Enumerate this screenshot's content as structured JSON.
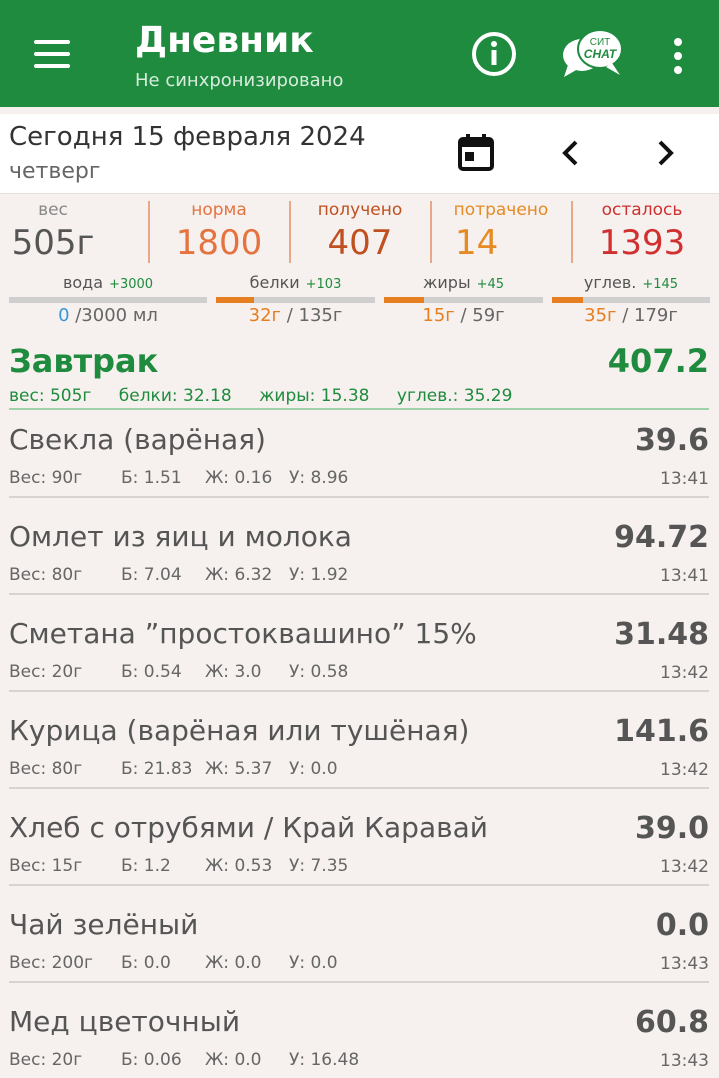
{
  "appbar": {
    "title": "Дневник",
    "subtitle": "Не синхронизировано",
    "chat_logo": [
      "СИТ",
      "CHAT"
    ],
    "icons": [
      "menu-icon",
      "info-icon",
      "chat-logo-icon",
      "more-vert-icon"
    ]
  },
  "date": {
    "full": "Сегодня 15 февраля 2024",
    "weekday": "четверг",
    "icons": [
      "calendar-icon",
      "chevron-left-icon",
      "chevron-right-icon"
    ]
  },
  "stats": [
    {
      "label": "вес",
      "value": "505г",
      "color": "#555555"
    },
    {
      "label": "норма",
      "value": "1800",
      "color": "#e5733f"
    },
    {
      "label": "получено",
      "value": "407",
      "color": "#c0501f"
    },
    {
      "label": "потрачено",
      "value": "14",
      "color": "#e68a23"
    },
    {
      "label": "осталось",
      "value": "1393",
      "color": "#d03030"
    }
  ],
  "macros": [
    {
      "label": "вода",
      "plus": "+3000",
      "current": "0",
      "rest": " /3000 мл",
      "fill": 0.0
    },
    {
      "label": "белки",
      "plus": "+103",
      "current": "32г",
      "rest": " / 135г",
      "fill": 0.237
    },
    {
      "label": "жиры",
      "plus": "+45",
      "current": "15г",
      "rest": " / 59г",
      "fill": 0.254
    },
    {
      "label": "углев.",
      "plus": "+145",
      "current": "35г",
      "rest": " / 179г",
      "fill": 0.196
    }
  ],
  "meal": {
    "title": "Завтрак",
    "total": "407.2",
    "weight": "вес: 505г",
    "protein": "белки: 32.18",
    "fat": "жиры: 15.38",
    "carbs": "углев.: 35.29"
  },
  "items": [
    {
      "name": "Свекла (варёная)",
      "kcal": "39.6",
      "weight": "Вес: 90г",
      "b": "Б: 1.51",
      "f": "Ж: 0.16",
      "c": "У: 8.96",
      "time": "13:41"
    },
    {
      "name": "Омлет из яиц и молока",
      "kcal": "94.72",
      "weight": "Вес: 80г",
      "b": "Б: 7.04",
      "f": "Ж: 6.32",
      "c": "У: 1.92",
      "time": "13:41"
    },
    {
      "name": "Сметана ”простоквашино” 15%",
      "kcal": "31.48",
      "weight": "Вес: 20г",
      "b": "Б: 0.54",
      "f": "Ж: 3.0",
      "c": "У: 0.58",
      "time": "13:42"
    },
    {
      "name": "Курица (варёная или тушёная)",
      "kcal": "141.6",
      "weight": "Вес: 80г",
      "b": "Б: 21.83",
      "f": "Ж: 5.37",
      "c": "У: 0.0",
      "time": "13:42"
    },
    {
      "name": "Хлеб с отрубями / Край Каравай",
      "kcal": "39.0",
      "weight": "Вес: 15г",
      "b": "Б: 1.2",
      "f": "Ж: 0.53",
      "c": "У: 7.35",
      "time": "13:42"
    },
    {
      "name": "Чай зелёный",
      "kcal": "0.0",
      "weight": "Вес: 200г",
      "b": "Б: 0.0",
      "f": "Ж: 0.0",
      "c": "У: 0.0",
      "time": "13:43"
    },
    {
      "name": "Мед цветочный",
      "kcal": "60.8",
      "weight": "Вес: 20г",
      "b": "Б: 0.06",
      "f": "Ж: 0.0",
      "c": "У: 16.48",
      "time": "13:43"
    }
  ]
}
